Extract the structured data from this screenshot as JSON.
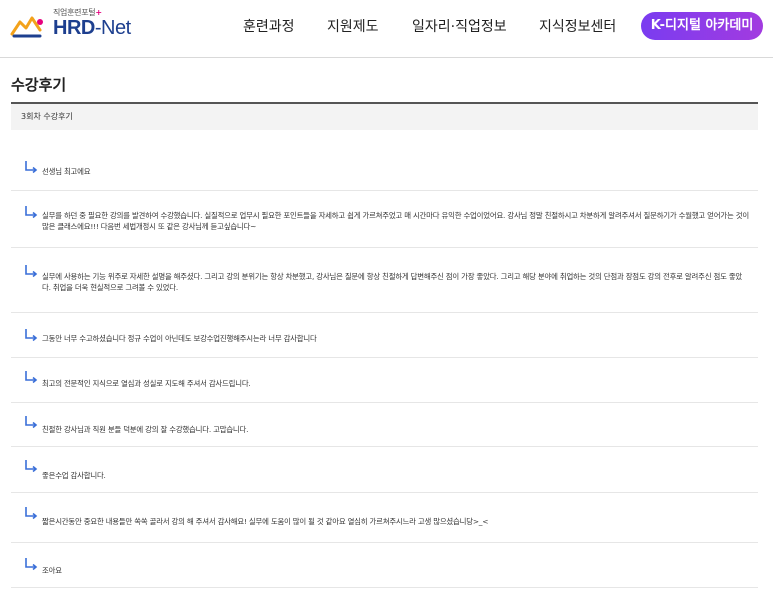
{
  "header": {
    "logo_sub": "직업훈련포털",
    "logo_plus": "+",
    "logo_hrd": "HRD",
    "logo_dash": "-",
    "logo_net": "Net",
    "nav": [
      "훈련과정",
      "지원제도",
      "일자리·직업정보",
      "지식정보센터"
    ],
    "k_digital": "K-디지털 아카데미"
  },
  "page": {
    "title": "수강후기",
    "section": "3회차 수강후기"
  },
  "reviews": [
    "선생님 최고에요",
    "실무를 하던 중 필요한 강의를 발견하여 수강했습니다. 실질적으로 업무시 필요한 포인트들을 자세하고 쉽게 가르쳐주었고 매 시간마다 유익한 수업이었어요. 강사님 정말 친절하시고 차분하게 알려주셔서 질문하기가 수월했고 얻어가는 것이 많은 클래스에요!!! 다음번 세법개정시 또 같은 강사님께 듣고싶습니다~",
    "실무에 사용하는 기능 위주로 자세한 설명을 해주셨다. 그리고 강의 분위기는 항상 차분했고, 강사님은 질문에 항상 친절하게 답변해주신 점이 가장 좋았다. 그리고 해당 분야에 취업하는 것의 단점과 장점도 강의 전후로 알려주신 점도 좋았다. 취업을 더욱 현실적으로 그려볼 수 있었다.",
    "그동안 너무 수고하셨습니다 정규 수업이 아닌데도 보강수업진행해주시는라 너무 감사합니다",
    "최고의 전문적인 지식으로 열심과 성실로 지도해 주셔서 감사드립니다.",
    "친절한 강사님과 직원 분들 덕분에 강의 잘 수강했습니다. 고맙습니다.",
    "좋은수업 감사합니다.",
    "짧은시간동안 중요한 내용들만 쏙쏙 골라서 강의 해 주셔서 감사해요! 실무에 도움이 많이 될 것 같아요 열심히 가르쳐주시느라 고생 많으셨습니당>_<",
    "조아요"
  ],
  "colors": {
    "brand_blue": "#1d3f8f",
    "arrow_blue": "#3a6fd8",
    "k_digital_purple": "#8a3ce8",
    "plus_pink": "#e6007e"
  },
  "icons": {
    "logo": "hrd-net-logo-icon",
    "reply": "reply-arrow-icon"
  }
}
